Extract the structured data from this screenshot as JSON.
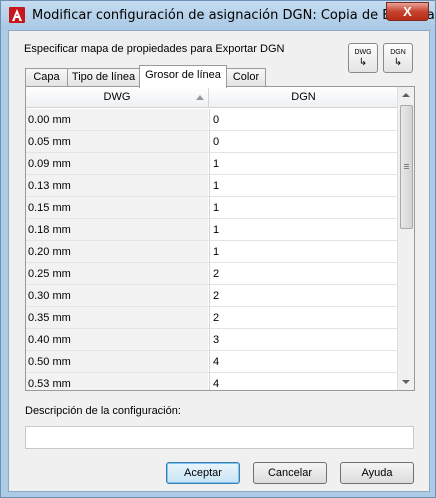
{
  "window": {
    "title": "Modificar configuración de asignación DGN: Copia de Estándar",
    "close_label": "X"
  },
  "spec_label": "Especificar mapa de propiedades para Exportar DGN",
  "toolbar": {
    "dwg_button": {
      "label": "DWG",
      "arrow": "↳"
    },
    "dgn_button": {
      "label": "DGN",
      "arrow": "↳"
    }
  },
  "tabs": [
    {
      "label": "Capa"
    },
    {
      "label": "Tipo de línea"
    },
    {
      "label": "Grosor de línea"
    },
    {
      "label": "Color"
    }
  ],
  "active_tab": "Grosor de línea",
  "grid": {
    "columns": [
      "DWG",
      "DGN"
    ],
    "rows": [
      {
        "dwg": "0.00 mm",
        "dgn": "0"
      },
      {
        "dwg": "0.05 mm",
        "dgn": "0"
      },
      {
        "dwg": "0.09 mm",
        "dgn": "1"
      },
      {
        "dwg": "0.13 mm",
        "dgn": "1"
      },
      {
        "dwg": "0.15 mm",
        "dgn": "1"
      },
      {
        "dwg": "0.18 mm",
        "dgn": "1"
      },
      {
        "dwg": "0.20 mm",
        "dgn": "1"
      },
      {
        "dwg": "0.25 mm",
        "dgn": "2"
      },
      {
        "dwg": "0.30 mm",
        "dgn": "2"
      },
      {
        "dwg": "0.35 mm",
        "dgn": "2"
      },
      {
        "dwg": "0.40 mm",
        "dgn": "3"
      },
      {
        "dwg": "0.50 mm",
        "dgn": "4"
      },
      {
        "dwg": "0.53 mm",
        "dgn": "4"
      }
    ]
  },
  "description": {
    "label": "Descripción de la configuración:",
    "value": ""
  },
  "buttons": {
    "ok": "Aceptar",
    "cancel": "Cancelar",
    "help": "Ayuda"
  }
}
